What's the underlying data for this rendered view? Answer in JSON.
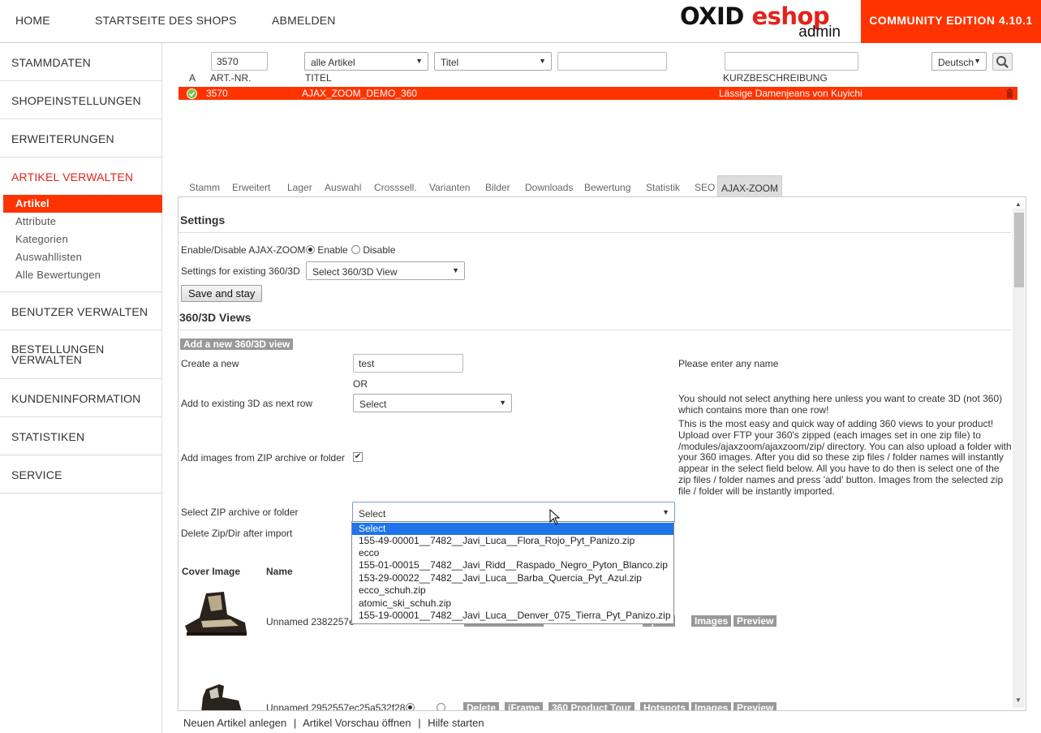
{
  "topnav": {
    "home": "HOME",
    "shop_start": "STARTSEITE DES SHOPS",
    "logout": "ABMELDEN"
  },
  "logo": {
    "brand_a": "OXID ",
    "brand_b": "eshop",
    "sub": "admin"
  },
  "edition": "COMMUNITY EDITION 4.10.1",
  "sidebar": {
    "items": [
      "STAMMDATEN",
      "SHOPEINSTELLUNGEN",
      "ERWEITERUNGEN",
      "ARTIKEL VERWALTEN",
      "BENUTZER VERWALTEN",
      "BESTELLUNGEN VERWALTEN",
      "KUNDENINFORMATION",
      "STATISTIKEN",
      "SERVICE"
    ],
    "subitems": [
      "Artikel",
      "Attribute",
      "Kategorien",
      "Auswahllisten",
      "Alle Bewertungen"
    ]
  },
  "filter": {
    "artnr_value": "3570",
    "category_select": "alle Artikel",
    "field_select": "Titel",
    "lang_select": "Deutsch"
  },
  "columns": {
    "a": "A",
    "artnr": "ART.-NR.",
    "title": "TITEL",
    "short": "KURZBESCHREIBUNG"
  },
  "row": {
    "artnr": "3570",
    "title": "AJAX_ZOOM_DEMO_360",
    "short": "Lässige Damenjeans von Kuyichi"
  },
  "tabs": [
    "Stamm",
    "Erweitert",
    "Lager",
    "Auswahl",
    "Crosssell.",
    "Varianten",
    "Bilder",
    "Downloads",
    "Bewertung",
    "Statistik",
    "SEO",
    "AJAX-ZOOM"
  ],
  "settings": {
    "heading": "Settings",
    "enable_label": "Enable/Disable AJAX-ZOOM",
    "enable": "Enable",
    "disable": "Disable",
    "existing_label": "Settings for existing 360/3D",
    "existing_select": "Select 360/3D View",
    "save_button": "Save and stay"
  },
  "views": {
    "heading": "360/3D Views",
    "add_new": "Add a new 360/3D view",
    "create_label": "Create a new",
    "create_value": "test",
    "create_hint": "Please enter any name",
    "or": "OR",
    "existing_label": "Add to existing 3D as next row",
    "existing_select": "Select",
    "existing_hint": "You should not select anything here unless you want to create 3D (not 360) which contains more than one row!",
    "zip_label": "Add images from ZIP archive or folder",
    "zip_hint": "This is the most easy and quick way of adding 360 views to your product! Upload over FTP your 360's zipped (each images set in one zip file) to /modules/ajaxzoom/ajaxzoom/zip/ directory. You can also upload a folder with your 360 images. After you did so these zip files / folder names will instantly appear in the select field below. All you have to do then is select one of the zip files / folder names and press 'add' button. Images from the selected zip file / folder will be instantly imported.",
    "select_zip_label": "Select ZIP archive or folder",
    "select_zip_value": "Select",
    "delete_zip_label": "Delete Zip/Dir after import",
    "dropdown_options": [
      "Select",
      "155-49-00001__7482__Javi_Luca__Flora_Rojo_Pyt_Panizo.zip",
      "ecco",
      "155-01-00015__7482__Javi_Ridd__Raspado_Negro_Pyton_Blanco.zip",
      "153-29-00022__7482__Javi_Luca__Barba_Quercia_Pyt_Azul.zip",
      "ecco_schuh.zip",
      "atomic_ski_schuh.zip",
      "155-19-00001__7482__Javi_Luca__Denver_075_Tierra_Pyt_Panizo.zip"
    ]
  },
  "table": {
    "col_cover": "Cover Image",
    "col_name": "Name",
    "rows": [
      {
        "name": "Unnamed 2382257e"
      },
      {
        "name": "Unnamed 2952557ec25a532f28"
      }
    ],
    "btn_images": "Images",
    "btn_preview": "Preview",
    "btn_hotspots_partial": "spots",
    "btn_delete": "Delete",
    "btn_iframe": "iFrame",
    "btn_tour": "360 Product Tour",
    "btn_hotspots": "Hotspots"
  },
  "footer": {
    "new_article": "Neuen Artikel anlegen",
    "preview": "Artikel Vorschau öffnen",
    "help": "Hilfe starten",
    "sep": "|"
  },
  "colors": {
    "accent": "#ff3300",
    "highlight": "#1e74e8"
  }
}
